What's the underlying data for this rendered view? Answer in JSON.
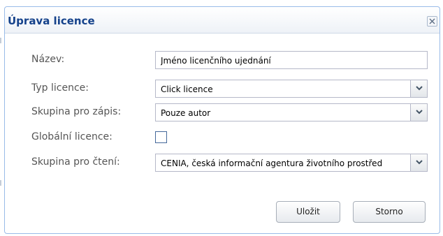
{
  "dialog": {
    "title": "Úprava licence",
    "close_icon": "close-icon"
  },
  "form": {
    "name_label": "Název:",
    "name_value": "Jméno licenčního ujednání",
    "type_label": "Typ licence:",
    "type_value": "Click licence",
    "write_group_label": "Skupina pro zápis:",
    "write_group_value": "Pouze autor",
    "global_label": "Globální licence:",
    "global_checked": false,
    "read_group_label": "Skupina pro čtení:",
    "read_group_value": "CENIA, česká informační agentura životního prostřed"
  },
  "buttons": {
    "save_label": "Uložit",
    "cancel_label": "Storno"
  },
  "colors": {
    "title_text": "#15428b",
    "border": "#99bbe8",
    "checkbox_border": "#44689a"
  }
}
